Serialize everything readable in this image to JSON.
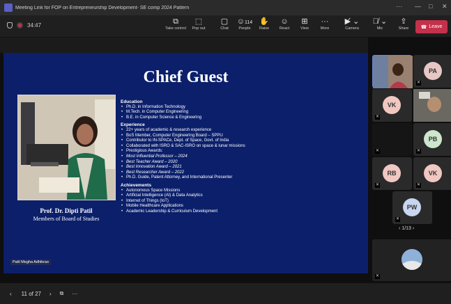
{
  "window": {
    "title": "Meeting Link for FOP on Entrepreneurship Development- SE comp 2024 Pattern",
    "controls": [
      "···",
      "—",
      "□",
      "✕"
    ]
  },
  "meeting": {
    "elapsed": "34:47"
  },
  "toolbar": {
    "take_control": "Take control",
    "pop_out": "Pop out",
    "chat": "Chat",
    "people": "People",
    "people_count": "114",
    "raise": "Raise",
    "react": "React",
    "view": "View",
    "more": "More",
    "camera": "Camera",
    "mic": "Mic",
    "share": "Share",
    "leave": "Leave"
  },
  "slide": {
    "title": "Chief Guest",
    "speaker_name": "Prof. Dr. Dipti Patil",
    "speaker_role": "Members of Board of Studies",
    "sections": [
      {
        "heading": "Education",
        "items": [
          "Ph.D. in Information Technology",
          "M.Tech. in Computer Engineering",
          "B.E. in Computer Science & Engineering"
        ]
      },
      {
        "heading": "Experience",
        "items": [
          "22+ years of academic & research experience",
          "BoS Member, Computer Engineering Board – SPPU",
          "Contributor to IN-SPACe, Dept. of Space, Govt. of India",
          "Collaborated with ISRO & SAC-ISRO on space & lunar missions",
          "Prestigious Awards:",
          "Most Influential Professor – 2024",
          "Best Teacher Award – 2020",
          "Best Innovation Award – 2021",
          "Best Researcher Award – 2022",
          "Ph.D. Guide, Patent Attorney, and International Presenter"
        ]
      },
      {
        "heading": "Achievements",
        "items": [
          "Autonomous Space Missions",
          "Artificial Intelligence (AI) & Data Analytics",
          "Internet of Things (IoT)",
          "Mobile Healthcare Applications",
          "Academic Leadership & Curriculum Development"
        ]
      }
    ],
    "presenter_label": "Patil Megha Adhikrao"
  },
  "participants": [
    {
      "initials": "PA",
      "color": "#e7c6c6"
    },
    {
      "initials": "VK",
      "color": "#f1c7c2"
    },
    {
      "initials": "PB",
      "color": "#cde6cd"
    },
    {
      "initials": "RB",
      "color": "#f1c7c2"
    },
    {
      "initials": "VK",
      "color": "#f1c7c2"
    },
    {
      "initials": "PW",
      "color": "#c8d6ef"
    }
  ],
  "participant_pager": "1/13",
  "bottom": {
    "page": "11 of 27"
  }
}
